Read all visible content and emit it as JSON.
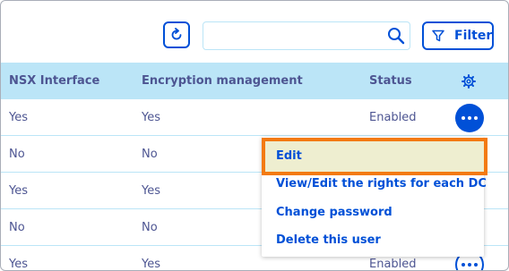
{
  "toolbar": {
    "refresh_icon": "refresh-icon",
    "search": {
      "value": "",
      "placeholder": "",
      "icon": "search-icon"
    },
    "filter_label": "Filter",
    "filter_icon": "funnel-icon"
  },
  "table": {
    "columns": [
      "NSX Interface",
      "Encryption management",
      "Status"
    ],
    "settings_icon": "gear-icon",
    "rows": [
      {
        "nsx": "Yes",
        "encryption": "Yes",
        "status": "Enabled"
      },
      {
        "nsx": "No",
        "encryption": "No",
        "status": ""
      },
      {
        "nsx": "Yes",
        "encryption": "Yes",
        "status": ""
      },
      {
        "nsx": "No",
        "encryption": "No",
        "status": ""
      },
      {
        "nsx": "Yes",
        "encryption": "Yes",
        "status": "Enabled"
      }
    ]
  },
  "context_menu": {
    "items": [
      "Edit",
      "View/Edit the rights for each DC",
      "Change password",
      "Delete this user"
    ]
  },
  "colors": {
    "accent": "#0050d7",
    "header_bg": "#bbe5f7",
    "text": "#4d5592",
    "highlight_border": "#f37a12",
    "highlight_bg": "#eeeed0"
  }
}
